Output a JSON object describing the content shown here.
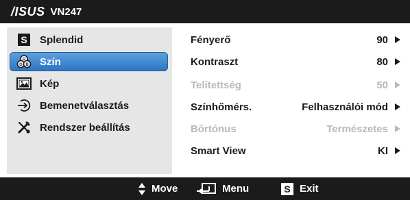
{
  "header": {
    "brand": "/ISUS",
    "model": "VN247"
  },
  "sidebar": {
    "items": [
      {
        "label": "Splendid",
        "icon": "splendid-s-icon"
      },
      {
        "label": "Szín",
        "icon": "color-circles-icon"
      },
      {
        "label": "Kép",
        "icon": "picture-icon"
      },
      {
        "label": "Bemenetválasztás",
        "icon": "input-select-icon"
      },
      {
        "label": "Rendszer beállítás",
        "icon": "wrench-screwdriver-icon"
      }
    ],
    "selected": "Szín"
  },
  "settings": {
    "rows": [
      {
        "label": "Fényerő",
        "value": "90",
        "enabled": true
      },
      {
        "label": "Kontraszt",
        "value": "80",
        "enabled": true
      },
      {
        "label": "Telítettség",
        "value": "50",
        "enabled": false
      },
      {
        "label": "Színhőmérs.",
        "value": "Felhasználói mód",
        "enabled": true
      },
      {
        "label": "Bőrtónus",
        "value": "Természetes",
        "enabled": false
      },
      {
        "label": "Smart View",
        "value": "KI",
        "enabled": true
      }
    ]
  },
  "footer": {
    "move_label": "Move",
    "menu_label": "Menu",
    "exit_label": "Exit"
  },
  "colors": {
    "bar": "#1b1b1b",
    "sidebar": "#e6e6e6",
    "highlight": "#2b74c5",
    "disabled_text": "#b9b9b9"
  }
}
